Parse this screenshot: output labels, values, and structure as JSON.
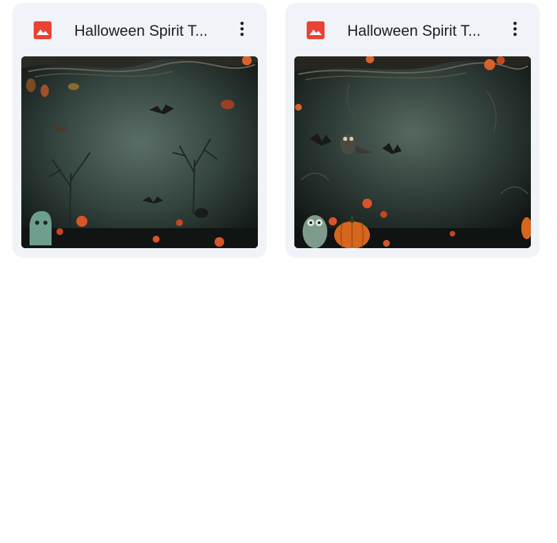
{
  "files": [
    {
      "title": "Halloween Spirit T...",
      "file_type_icon": "image-file-icon",
      "menu_icon": "more-vert-icon",
      "thumbnail_icon": "halloween-scene-thumbnail"
    },
    {
      "title": "Halloween Spirit T...",
      "file_type_icon": "image-file-icon",
      "menu_icon": "more-vert-icon",
      "thumbnail_icon": "halloween-scene-thumbnail"
    }
  ],
  "colors": {
    "card_background": "#f0f4f9",
    "image_icon_red": "#ea4335",
    "title_text": "#1f1f1f",
    "page_background": "#ffffff"
  }
}
